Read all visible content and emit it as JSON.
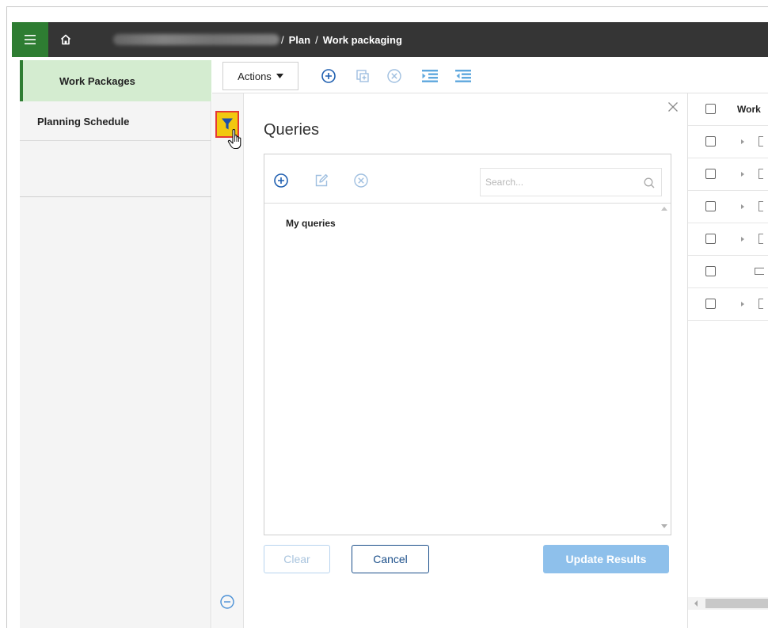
{
  "header": {
    "breadcrumb": [
      "Plan",
      "Work packaging"
    ],
    "separator": "/",
    "brand_color": "#2e7d32"
  },
  "leftnav": {
    "items": [
      {
        "label": "Work Packages",
        "active": true
      },
      {
        "label": "Planning Schedule",
        "active": false
      }
    ]
  },
  "toolbar": {
    "actions_label": "Actions",
    "icons": [
      "add-icon",
      "copy-add-icon",
      "delete-icon",
      "indent-icon",
      "outdent-icon"
    ]
  },
  "queries": {
    "title": "Queries",
    "search_placeholder": "Search...",
    "tree": [
      "My queries"
    ],
    "buttons": {
      "clear": "Clear",
      "cancel": "Cancel",
      "update": "Update Results"
    }
  },
  "grid": {
    "header": "Work",
    "row_count": 6
  }
}
